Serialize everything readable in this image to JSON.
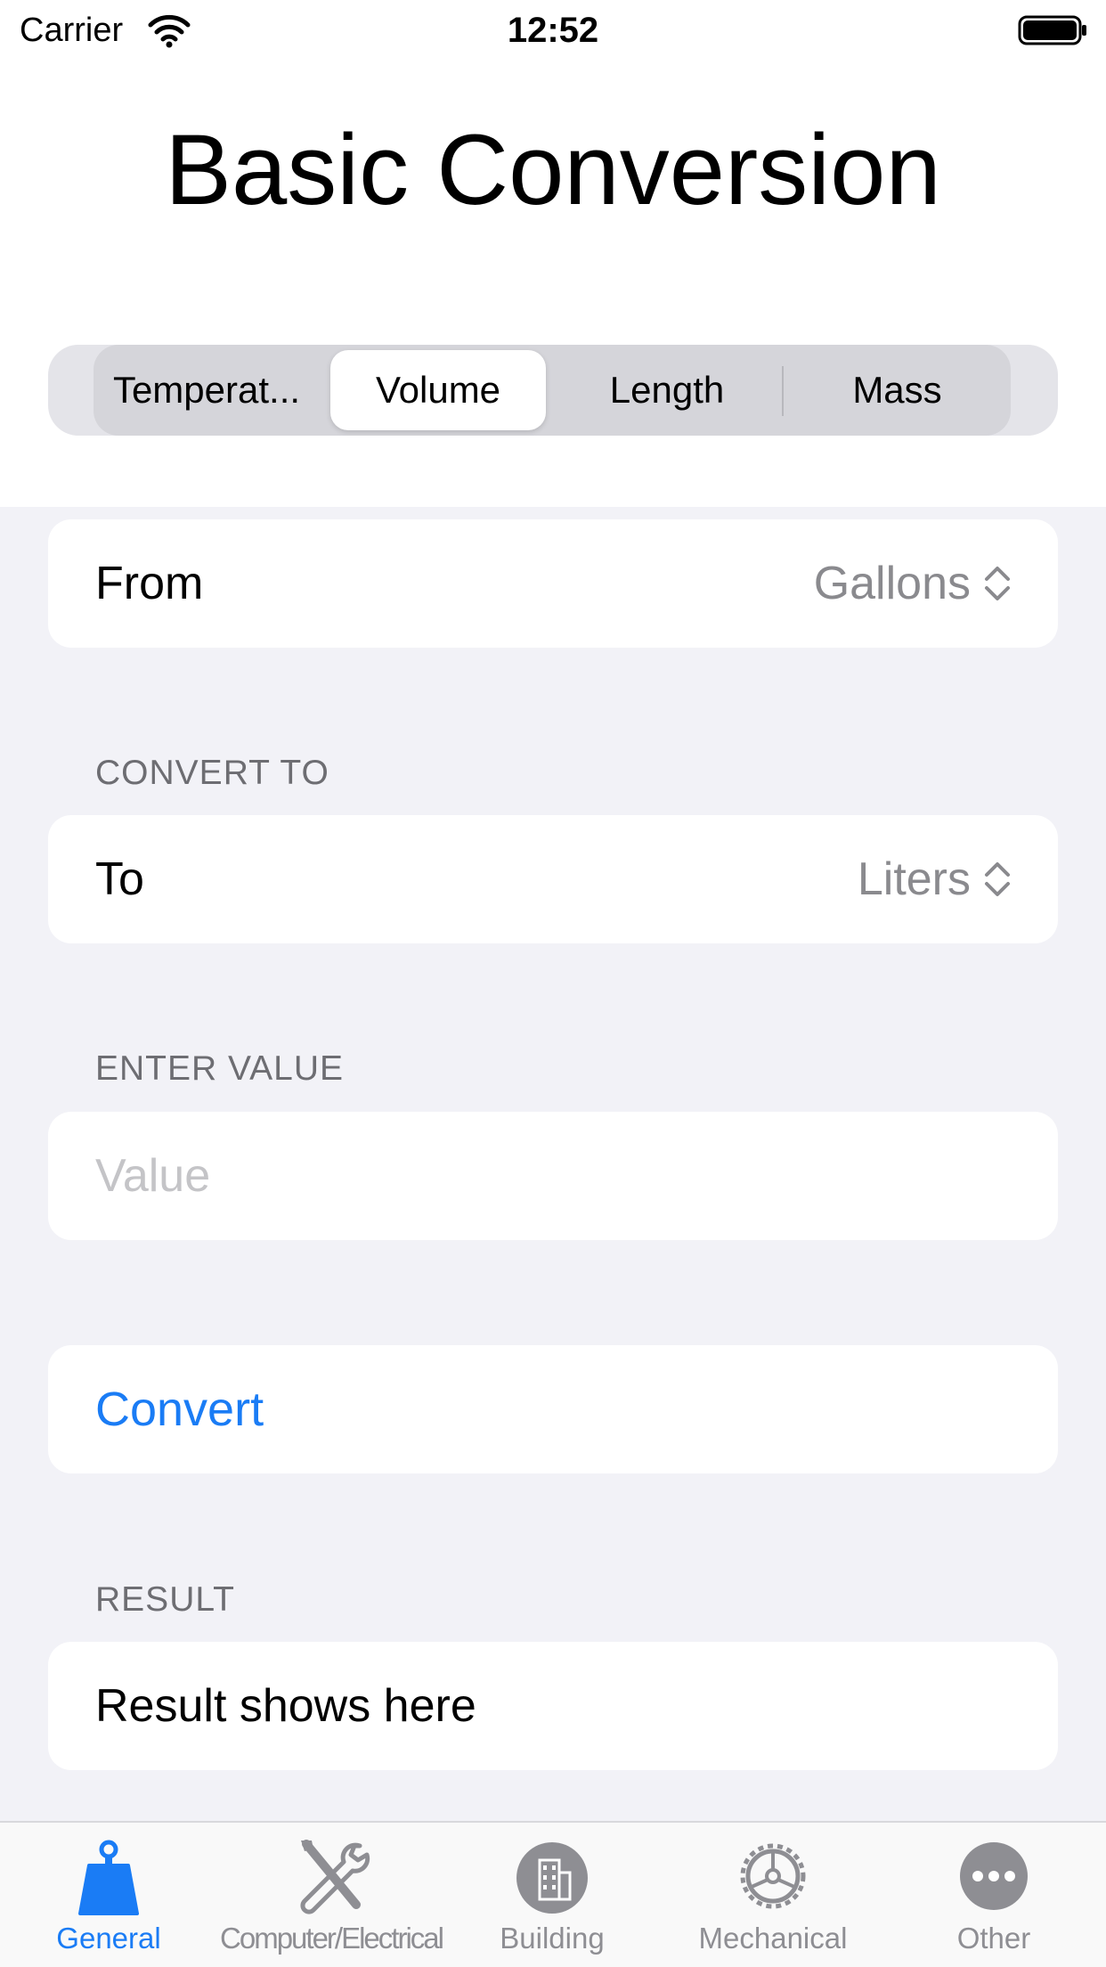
{
  "status_bar": {
    "carrier": "Carrier",
    "time": "12:52"
  },
  "title": "Basic Conversion",
  "segments": [
    {
      "label": "Temperat...",
      "selected": false
    },
    {
      "label": "Volume",
      "selected": true
    },
    {
      "label": "Length",
      "selected": false
    },
    {
      "label": "Mass",
      "selected": false
    }
  ],
  "from": {
    "label": "From",
    "value": "Gallons"
  },
  "convert_to": {
    "header": "CONVERT TO",
    "label": "To",
    "value": "Liters"
  },
  "enter_value": {
    "header": "ENTER VALUE",
    "placeholder": "Value",
    "value": ""
  },
  "convert_button": {
    "label": "Convert"
  },
  "result": {
    "header": "RESULT",
    "text": "Result shows here"
  },
  "tabs": [
    {
      "label": "General",
      "icon": "weight-icon",
      "active": true
    },
    {
      "label": "Computer/Electrical",
      "icon": "tools-icon",
      "active": false
    },
    {
      "label": "Building",
      "icon": "building-icon",
      "active": false
    },
    {
      "label": "Mechanical",
      "icon": "gear-wheel-icon",
      "active": false
    },
    {
      "label": "Other",
      "icon": "more-icon",
      "active": false
    }
  ],
  "colors": {
    "accent": "#1a7cf5",
    "inactive_tab": "#8e8e93",
    "background": "#f2f2f7"
  }
}
